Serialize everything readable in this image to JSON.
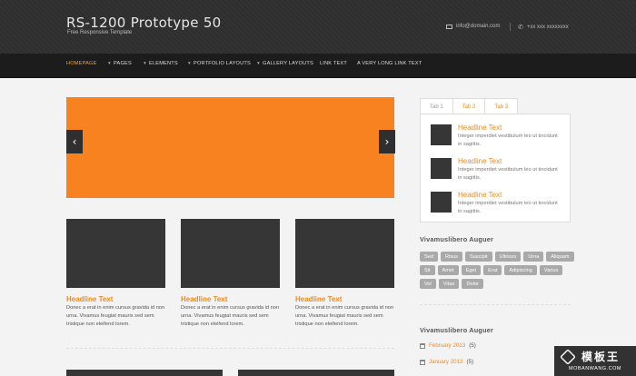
{
  "header": {
    "title": "RS-1200 Prototype 50",
    "subtitle": "Free Responsive Template",
    "email": "info@domain.com",
    "phone": "+xx xxx xxxxxxxx"
  },
  "nav": {
    "items": [
      {
        "label": "HOMEPAGE",
        "active": true,
        "bullet": false
      },
      {
        "label": "PAGES",
        "active": false,
        "bullet": true
      },
      {
        "label": "ELEMENTS",
        "active": false,
        "bullet": true
      },
      {
        "label": "PORTFOLIO LAYOUTS",
        "active": false,
        "bullet": true
      },
      {
        "label": "GALLERY LAYOUTS",
        "active": false,
        "bullet": true
      },
      {
        "label": "LINK TEXT",
        "active": false,
        "bullet": false
      },
      {
        "label": "A VERY LONG LINK TEXT",
        "active": false,
        "bullet": false
      }
    ],
    "bullet_char": "▾"
  },
  "slider": {
    "prev_glyph": "‹",
    "next_glyph": "›",
    "accent": "#f7821f"
  },
  "cards": [
    {
      "title": "Headline Text",
      "text": "Donec a erat in enim cursus gravida id non urna. Vivamus feugiat mauris sed sem tristique non eleifend lorem."
    },
    {
      "title": "Headline Text",
      "text": "Donec a erat in enim cursus gravida id non urna. Vivamus feugiat mauris sed sem tristique non eleifend lorem."
    },
    {
      "title": "Headline Text",
      "text": "Donec a erat in enim cursus gravida id non urna. Vivamus feugiat mauris sed sem tristique non eleifend lorem."
    }
  ],
  "sidebar": {
    "tabs": [
      {
        "label": "Tab 1",
        "active": true
      },
      {
        "label": "Tab 2",
        "active": false
      },
      {
        "label": "Tab 3",
        "active": false
      }
    ],
    "tab_items": [
      {
        "title": "Headline Text",
        "text": "Integer imperdiet vestibulum leo ut tincidunt in sagittis."
      },
      {
        "title": "Headline Text",
        "text": "Integer imperdiet vestibulum leo ut tincidunt in sagittis."
      },
      {
        "title": "Headline Text",
        "text": "Integer imperdiet vestibulum leo ut tincidunt in sagittis."
      }
    ],
    "tags_heading": "Vivamuslibero Auguer",
    "tags": [
      "Sed",
      "Risus",
      "Suscipit",
      "Ultrices",
      "Urna",
      "Aliquam",
      "Sit",
      "Amet",
      "Eget",
      "Erat",
      "Adipiscing",
      "Varius",
      "Vel",
      "Vitae",
      "Dolor"
    ],
    "archive_heading": "Vivamuslibero Auguer",
    "archive": [
      {
        "month": "February 2013",
        "count": "(5)"
      },
      {
        "month": "January 2013",
        "count": "(5)"
      }
    ]
  },
  "watermark": {
    "text": "模板王",
    "url": "MOBANWANG.COM"
  }
}
